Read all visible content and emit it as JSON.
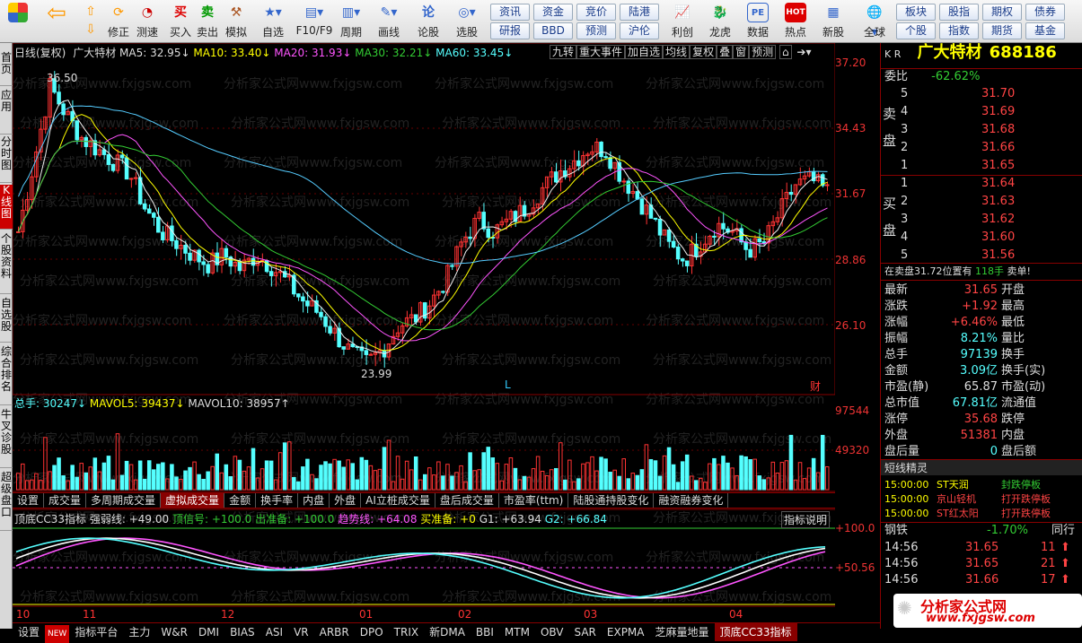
{
  "toolbar": {
    "left_buttons": [
      {
        "label": "修正",
        "icon": "up-down-arrows-icon"
      },
      {
        "label": "测速",
        "icon": "clock-icon"
      },
      {
        "label": "买入",
        "icon": "buy-icon",
        "glyph": "买"
      },
      {
        "label": "卖出",
        "icon": "sell-icon",
        "glyph": "卖"
      },
      {
        "label": "模拟",
        "icon": "hammer-icon"
      },
      {
        "label": "自选",
        "icon": "star-icon"
      },
      {
        "label": "F10/F9",
        "icon": "f10-icon"
      },
      {
        "label": "周期",
        "icon": "chart-period-icon"
      },
      {
        "label": "画线",
        "icon": "pen-icon"
      },
      {
        "label": "论股",
        "icon": "discuss-icon",
        "glyph": "论"
      },
      {
        "label": "选股",
        "icon": "select-stock-icon"
      }
    ],
    "grid_buttons": [
      "资讯",
      "资金",
      "竞价",
      "陆港",
      "研报",
      "BBD",
      "预测",
      "沪伦"
    ],
    "right_buttons": [
      {
        "label": "利创",
        "icon": "chart-icon"
      },
      {
        "label": "龙虎",
        "icon": "dragon-tiger-icon"
      },
      {
        "label": "数据",
        "icon": "pe-icon",
        "glyph": "PE"
      },
      {
        "label": "热点",
        "icon": "hot-icon",
        "glyph": "HOT"
      },
      {
        "label": "新股",
        "icon": "new-stock-icon"
      }
    ],
    "global_label": "全球",
    "grid_buttons2": [
      "板块",
      "股指",
      "期权",
      "债券",
      "个股",
      "指数",
      "期货",
      "基金"
    ]
  },
  "leftnav": [
    "首页",
    "应用",
    "分时图",
    "K线图",
    "个股资料",
    "自选股",
    "综合排名",
    "牛叉诊股",
    "超级盘口"
  ],
  "main_header": {
    "period": "日线(复权)",
    "name": "广大特材",
    "ma5": "MA5: 32.95↓",
    "ma10": "MA10: 33.40↓",
    "ma20": "MA20: 31.93↓",
    "ma30": "MA30: 32.21↓",
    "ma60": "MA60: 33.45↓",
    "buttons": [
      "九转",
      "重大事件",
      "加自选",
      "均线",
      "复权",
      "叠",
      "窗",
      "预测"
    ]
  },
  "price_axis": [
    "37.20",
    "34.43",
    "31.67",
    "28.86",
    "26.10"
  ],
  "annotations": {
    "high": "36.50",
    "low": "23.99",
    "l_mark": "L",
    "cai_mark": "财"
  },
  "volume": {
    "label": "总手: 30247↓",
    "mavol5": "MAVOL5: 39437↓",
    "mavol10": "MAVOL10: 38957↑",
    "axis": [
      "97544",
      "49320"
    ]
  },
  "sub_tabs": [
    "设置",
    "成交量",
    "多周期成交量",
    "虚拟成交量",
    "金额",
    "换手率",
    "内盘",
    "外盘",
    "AI立桩成交量",
    "盘后成交量",
    "市盈率(ttm)",
    "陆股通持股变化",
    "融资融券变化"
  ],
  "sub_tabs_selected": "虚拟成交量",
  "indicator": {
    "name": "顶底CC33指标",
    "strong": "强弱线: +49.00",
    "top": "顶信号: +100.0",
    "out": "出准备: +100.0",
    "trend": "趋势线: +64.08",
    "buy_prep": "买准备: +0",
    "g1": "G1: +63.94",
    "g2": "G2: +66.84",
    "explain": "指标说明",
    "axis": [
      "+100.0",
      "+50.56"
    ]
  },
  "months": [
    "10",
    "11",
    "12",
    "01",
    "02",
    "03",
    "04"
  ],
  "bottom_tabs": [
    "设置",
    "NEW",
    "指标平台",
    "主力",
    "W&R",
    "DMI",
    "BIAS",
    "ASI",
    "VR",
    "ARBR",
    "DPO",
    "TRIX",
    "新DMA",
    "BBI",
    "MTM",
    "OBV",
    "SAR",
    "EXPMA",
    "芝麻量地量",
    "顶底CC33指标"
  ],
  "bottom_selected": "顶底CC33指标",
  "watermark": "分析家公式网www.fxjgsw.com",
  "quote": {
    "kr": "K R",
    "name": "广大特材",
    "code": "688186",
    "weibi_label": "委比",
    "weibi": "-62.62%",
    "sell_label": "卖盘",
    "buy_label": "买盘",
    "sells": [
      {
        "n": "5",
        "p": "31.70"
      },
      {
        "n": "4",
        "p": "31.69"
      },
      {
        "n": "3",
        "p": "31.68"
      },
      {
        "n": "2",
        "p": "31.66"
      },
      {
        "n": "1",
        "p": "31.65"
      }
    ],
    "buys": [
      {
        "n": "1",
        "p": "31.64"
      },
      {
        "n": "2",
        "p": "31.63"
      },
      {
        "n": "3",
        "p": "31.62"
      },
      {
        "n": "4",
        "p": "31.60"
      },
      {
        "n": "5",
        "p": "31.56"
      }
    ],
    "ticker": "在卖盘31.72位置有",
    "ticker_qty": "118手",
    "ticker_tag": "卖单!",
    "stats": [
      {
        "k": "最新",
        "v": "31.65",
        "k2": "开盘"
      },
      {
        "k": "涨跌",
        "v": "+1.92",
        "k2": "最高"
      },
      {
        "k": "涨幅",
        "v": "+6.46%",
        "k2": "最低"
      },
      {
        "k": "振幅",
        "v": "8.21%",
        "k2": "量比"
      },
      {
        "k": "总手",
        "v": "97139",
        "k2": "换手"
      },
      {
        "k": "金额",
        "v": "3.09亿",
        "k2": "换手(实)"
      },
      {
        "k": "市盈(静)",
        "v": "65.87",
        "k2": "市盈(动)"
      },
      {
        "k": "总市值",
        "v": "67.81亿",
        "k2": "流通值"
      },
      {
        "k": "涨停",
        "v": "35.68",
        "k2": "跌停"
      },
      {
        "k": "外盘",
        "v": "51381",
        "k2": "内盘"
      },
      {
        "k": "盘后量",
        "v": "0",
        "k2": "盘后额"
      }
    ],
    "news_title": "短线精灵",
    "news": [
      {
        "t": "15:00:00",
        "s": "ST天润",
        "e": "封跌停板"
      },
      {
        "t": "15:00:00",
        "s": "京山轻机",
        "e": "打开跌停板"
      },
      {
        "t": "15:00:00",
        "s": "ST红太阳",
        "e": "打开跌停板"
      }
    ],
    "sector": "钢铁",
    "sector_chg": "-1.70%",
    "sector_tab": "同行",
    "ticks": [
      {
        "t": "14:56",
        "p": "31.65",
        "q": "11"
      },
      {
        "t": "14:56",
        "p": "31.65",
        "q": "21"
      },
      {
        "t": "14:56",
        "p": "31.66",
        "q": "17"
      }
    ],
    "logo": "分析家公式网",
    "logo_url": "www.fxjgsw.com"
  }
}
